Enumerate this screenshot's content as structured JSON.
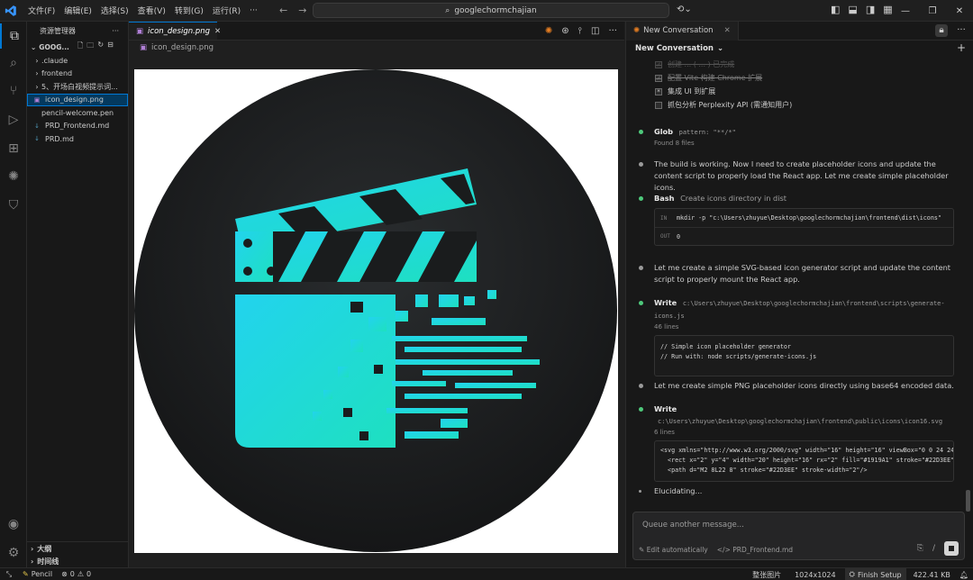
{
  "menu": [
    "文件(F)",
    "编辑(E)",
    "选择(S)",
    "查看(V)",
    "转到(G)",
    "运行(R)",
    "···"
  ],
  "search": {
    "text": "googlechormchajian"
  },
  "sidebar": {
    "title": "资源管理器",
    "more": "···",
    "folder": "GOOG...",
    "items": [
      {
        "label": ".claude",
        "kind": "folder"
      },
      {
        "label": "frontend",
        "kind": "folder"
      },
      {
        "label": "5、开场白视频提示词...",
        "kind": "folder"
      },
      {
        "label": "icon_design.png",
        "kind": "image",
        "selected": true
      },
      {
        "label": "pencil-welcome.pen",
        "kind": "file"
      },
      {
        "label": "PRD_Frontend.md",
        "kind": "md"
      },
      {
        "label": "PRD.md",
        "kind": "md"
      }
    ],
    "outline": "大纲",
    "timeline": "时间线"
  },
  "editor": {
    "tab_label": "icon_design.png",
    "breadcrumb": "icon_design.png"
  },
  "chat": {
    "tab_label": "New Conversation",
    "header": "New Conversation",
    "todos": [
      {
        "label": "创建 ... ( ... ) 已完成",
        "done": true
      },
      {
        "label": "配置 Vite 构建 Chrome 扩展",
        "done": true
      },
      {
        "label": "集成 UI 到扩展",
        "done": false,
        "inprogress": true
      },
      {
        "label": "抓包分析 Perplexity API (需通知用户)",
        "done": false
      }
    ],
    "steps": [
      {
        "tool": "Glob",
        "arg": "pattern: \"**/*\"",
        "note": "Found 8 files"
      },
      {
        "text": "The build is working. Now I need to create placeholder icons and update the content script to properly load the React app. Let me create simple placeholder icons."
      },
      {
        "tool": "Bash",
        "desc": "Create icons directory in dist",
        "in_label": "IN",
        "in": "mkdir -p \"c:\\Users\\zhuyue\\Desktop\\googlechormchajian\\frontend\\dist\\icons\"",
        "out_label": "OUT",
        "out": "0"
      },
      {
        "text": "Let me create a simple SVG-based icon generator script and update the content script to properly mount the React app."
      },
      {
        "tool": "Write",
        "arg": "c:\\Users\\zhuyue\\Desktop\\googlechormchajian\\frontend\\scripts\\generate-icons.js",
        "note": "46 lines",
        "code": "// Simple icon placeholder generator\n// Run with: node scripts/generate-icons.js"
      },
      {
        "text": "Let me create simple PNG placeholder icons directly using base64 encoded data."
      },
      {
        "tool": "Write",
        "arg": "c:\\Users\\zhuyue\\Desktop\\googlechormchajian\\frontend\\public\\icons\\icon16.svg",
        "note": "6 lines",
        "code": "<svg xmlns=\"http://www.w3.org/2000/svg\" width=\"16\" height=\"16\" viewBox=\"0 0 24 24\" fill=\"n\n  <rect x=\"2\" y=\"4\" width=\"20\" height=\"16\" rx=\"2\" fill=\"#1919A1\" stroke=\"#22D3EE\" stroke-w\n  <path d=\"M2 8L22 8\" stroke=\"#22D3EE\" stroke-width=\"2\"/>"
      }
    ],
    "status": "Elucidating...",
    "input_placeholder": "Queue another message...",
    "edit_mode": "Edit automatically",
    "context_file": "PRD_Frontend.md"
  },
  "statusbar": {
    "pencil": "Pencil",
    "problems": "0",
    "warnings": "0",
    "view_mode": "整张图片",
    "dimensions": "1024x1024",
    "finish": "Finish Setup",
    "filesize": "422.41 KB"
  },
  "colors": {
    "accent": "#0078d4",
    "cyan": "#22D3EE",
    "canvas": "#ffffff"
  }
}
